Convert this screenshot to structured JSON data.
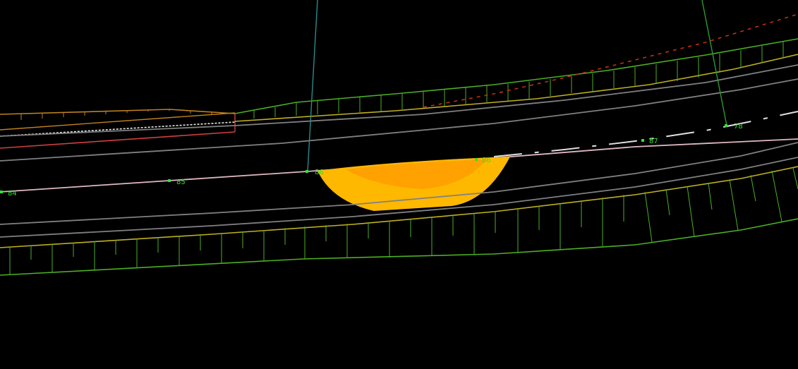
{
  "view": {
    "background": "#000000"
  },
  "colors": {
    "top_of_slope": "#4caf23",
    "road_edge": "#c0b020",
    "gray_lane": "#808080",
    "light_lane": "#d0d0d0",
    "pink_centerline": "#e0b8c0",
    "red_boundary": "#d04040",
    "orange_edge": "#c08020",
    "red_dashed": "#c03010",
    "cyan_leader": "#2a8c8c",
    "green_leader": "#2a9a30",
    "label_green": "#33e033",
    "highlight_fill": "#ffb800",
    "highlight_core": "#ff9a00"
  },
  "stations": [
    {
      "id": "st-84",
      "text": "84"
    },
    {
      "id": "st-85",
      "text": "85"
    },
    {
      "id": "st-86",
      "text": "86"
    },
    {
      "id": "st-86b",
      "text": "86"
    },
    {
      "id": "st-87",
      "text": "87"
    },
    {
      "id": "st-78",
      "text": "78"
    }
  ],
  "highlight": {
    "name": "selected-region"
  }
}
